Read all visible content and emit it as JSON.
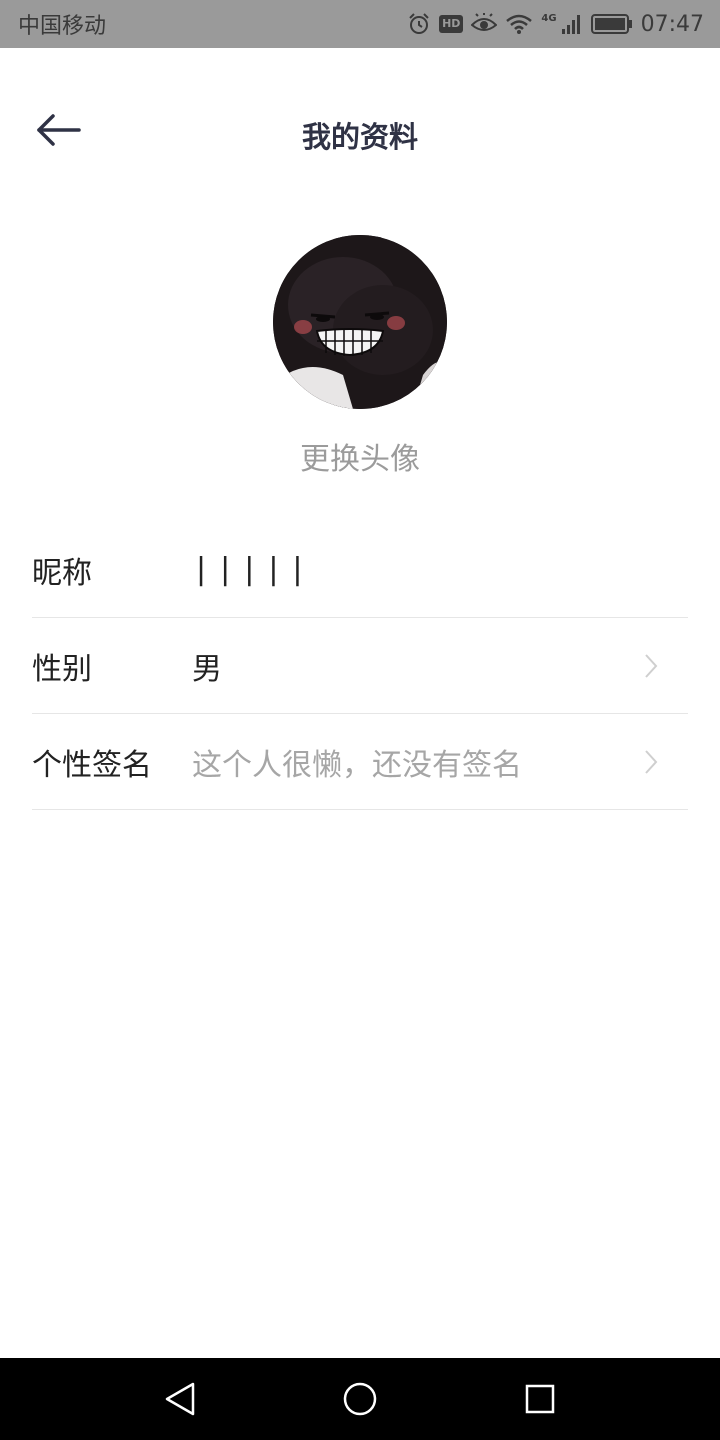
{
  "status_bar": {
    "carrier": "中国移动",
    "hd_label": "HD",
    "network_label": "4G",
    "time": "07:47",
    "icons": [
      "alarm-icon",
      "hd-icon",
      "eye-icon",
      "wifi-icon",
      "signal-icon",
      "battery-icon"
    ]
  },
  "header": {
    "title": "我的资料",
    "back_icon": "arrow-left-icon"
  },
  "profile": {
    "avatar_icon": "avatar-image",
    "change_avatar_label": "更换头像"
  },
  "rows": [
    {
      "label": "昵称",
      "value": "|||||",
      "has_chevron": false
    },
    {
      "label": "性别",
      "value": "男",
      "has_chevron": true
    },
    {
      "label": "个性签名",
      "value": "这个人很懒，还没有签名",
      "placeholder": true,
      "has_chevron": true
    }
  ],
  "nav_bar": {
    "icons": [
      "back-triangle-icon",
      "home-circle-icon",
      "recents-square-icon"
    ]
  },
  "colors": {
    "status_bar_bg": "#9a9a9a",
    "title": "#2f3245",
    "secondary_text": "#9b9b9b",
    "nav_bar_bg": "#000000"
  }
}
